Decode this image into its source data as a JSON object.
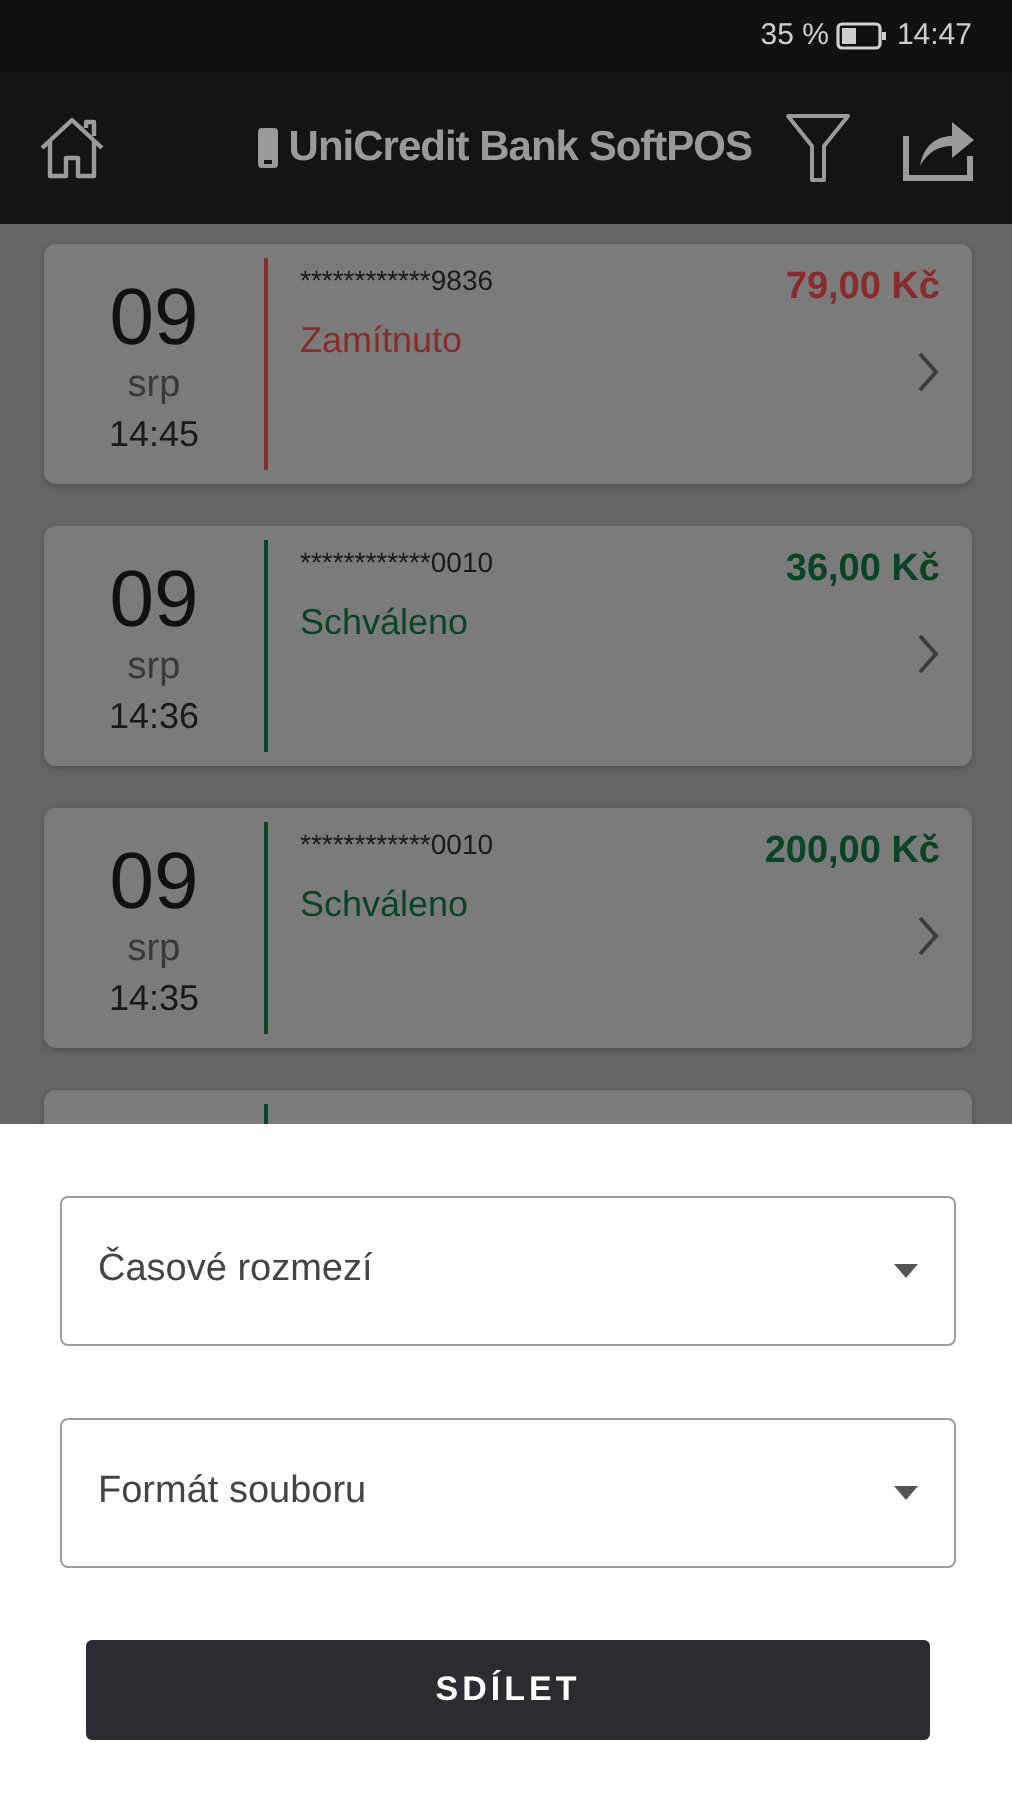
{
  "status_bar": {
    "battery": "35 %",
    "time": "14:47"
  },
  "app_bar": {
    "title": "UniCredit Bank SoftPOS"
  },
  "transactions": [
    {
      "kind": "full",
      "day": "09",
      "month": "srp",
      "time": "14:45",
      "card": "************9836",
      "status": "Zamítnuto",
      "amount": "79,00 Kč",
      "color": "#8a2b2e"
    },
    {
      "kind": "full",
      "day": "09",
      "month": "srp",
      "time": "14:36",
      "card": "************0010",
      "status": "Schváleno",
      "amount": "36,00 Kč",
      "color": "#0a4428"
    },
    {
      "kind": "full",
      "day": "09",
      "month": "srp",
      "time": "14:35",
      "card": "************0010",
      "status": "Schváleno",
      "amount": "200,00 Kč",
      "color": "#0a4428"
    },
    {
      "kind": "partial",
      "color": "#0a4428"
    }
  ],
  "share_sheet": {
    "fields": [
      {
        "placeholder": "Časové rozmezí"
      },
      {
        "placeholder": "Formát souboru"
      }
    ],
    "button": "SDÍLET"
  }
}
